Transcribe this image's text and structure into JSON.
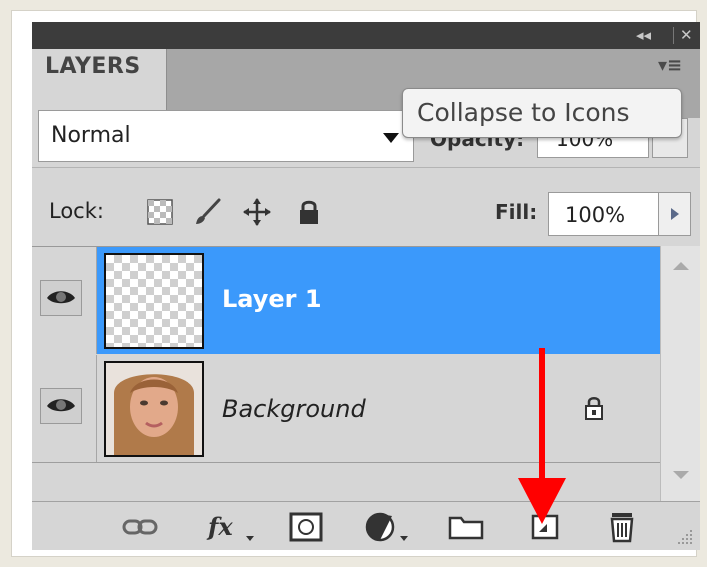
{
  "panel": {
    "title": "LAYERS",
    "blend_mode": "Normal",
    "opacity_label": "Opacity:",
    "opacity_value": "100%",
    "lock_label": "Lock:",
    "fill_label": "Fill:",
    "fill_value": "100%"
  },
  "tooltip": {
    "text": "Collapse to Icons"
  },
  "layers": [
    {
      "name": "Layer 1",
      "visible": true,
      "selected": true,
      "thumbnail": "transparent-checkerboard"
    },
    {
      "name": "Background",
      "visible": true,
      "selected": false,
      "locked": true,
      "thumbnail": "portrait-photo"
    }
  ],
  "colors": {
    "selection": "#3b99fb",
    "panel_bg": "#d6d6d6",
    "topbar": "#3c3c3c",
    "annotation_arrow": "#ff0000"
  },
  "bottom_icons": [
    "link-layers-icon",
    "fx-icon",
    "add-mask-icon",
    "adjustment-layer-icon",
    "new-group-icon",
    "new-layer-icon",
    "delete-layer-icon"
  ]
}
